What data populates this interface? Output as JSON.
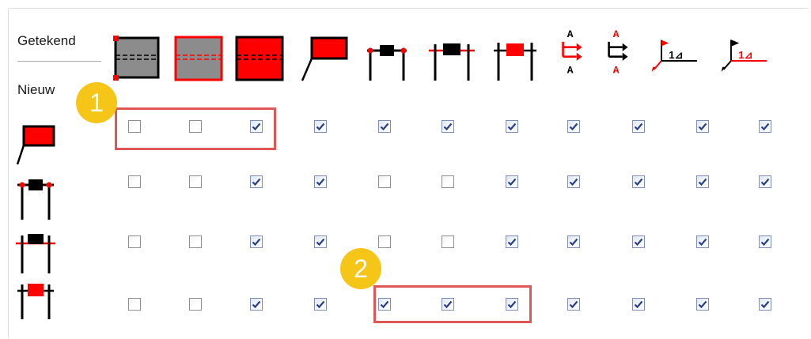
{
  "labels": {
    "drawn": "Getekend",
    "new": "Nieuw"
  },
  "callouts": [
    {
      "number": "1"
    },
    {
      "number": "2"
    }
  ],
  "accent_color": "#ff0000",
  "column_icons": [
    "section-gray-dashed-icon",
    "section-gray-red-border-icon",
    "section-red-filled-icon",
    "leader-red-box-icon",
    "beam-black-red-dots-icon",
    "beam-black-red-line-icon",
    "beam-red-block-icon",
    "section-arrows-red-icon",
    "section-arrows-black-icon",
    "level-red-arrow-icon",
    "level-black-arrow-icon"
  ],
  "row_icons": [
    "leader-red-box-icon",
    "beam-black-red-dots-icon",
    "beam-black-red-line-icon",
    "beam-red-block-icon"
  ],
  "section_glyph": "A",
  "level_glyph": "1⊿",
  "grid": [
    [
      false,
      false,
      true,
      true,
      true,
      true,
      true,
      true,
      true,
      true,
      true
    ],
    [
      false,
      false,
      true,
      true,
      false,
      false,
      true,
      true,
      true,
      true,
      true
    ],
    [
      false,
      false,
      true,
      true,
      false,
      false,
      true,
      true,
      true,
      true,
      true
    ],
    [
      false,
      false,
      true,
      true,
      true,
      true,
      true,
      true,
      true,
      true,
      true
    ]
  ]
}
